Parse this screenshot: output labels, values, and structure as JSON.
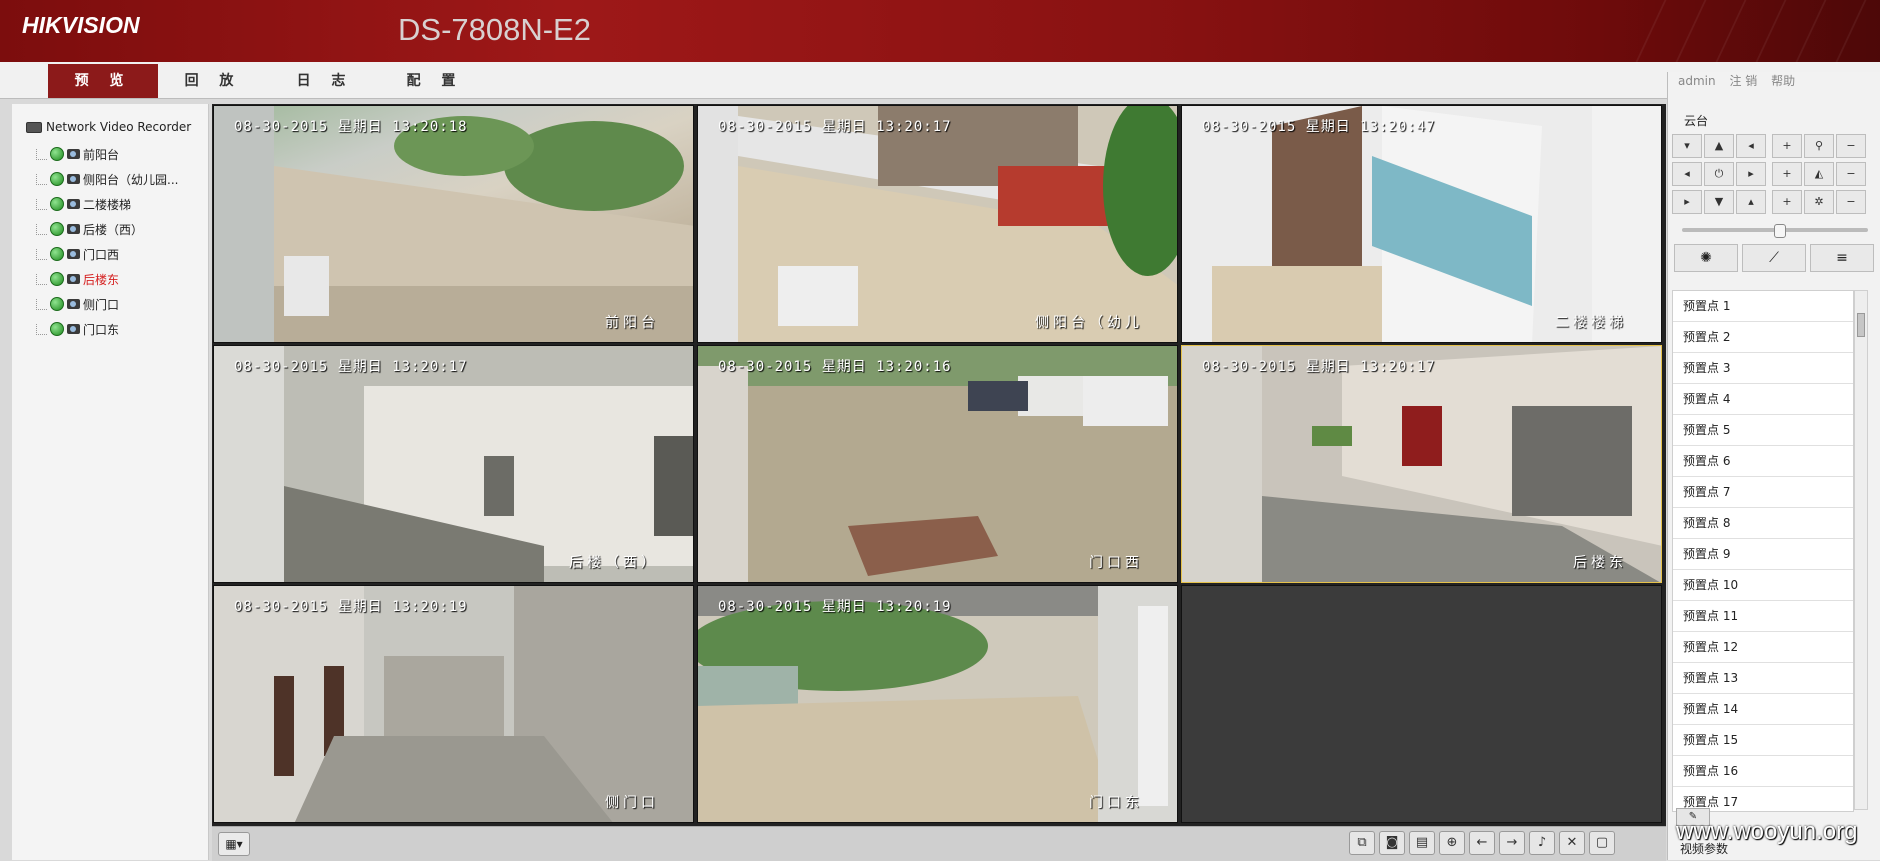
{
  "header": {
    "logo": "HIKVISION",
    "model": "DS-7808N-E2"
  },
  "nav": {
    "tabs": [
      "预 览",
      "回 放",
      "日 志",
      "配 置"
    ],
    "active_tab": "预 览",
    "user": "admin",
    "logout": "注 销",
    "help": "帮助"
  },
  "tree": {
    "root": "Network Video Recorder",
    "cameras": [
      {
        "name": "前阳台",
        "state": "normal"
      },
      {
        "name": "侧阳台（幼儿园...",
        "state": "normal"
      },
      {
        "name": "二楼楼梯",
        "state": "normal"
      },
      {
        "name": "后楼（西）",
        "state": "normal"
      },
      {
        "name": "门口西",
        "state": "normal"
      },
      {
        "name": "后楼东",
        "state": "selected"
      },
      {
        "name": "侧门口",
        "state": "normal"
      },
      {
        "name": "门口东",
        "state": "normal"
      }
    ]
  },
  "video": {
    "cells": [
      {
        "timestamp": "08-30-2015 星期日 13:20:18",
        "name": "前阳台"
      },
      {
        "timestamp": "08-30-2015 星期日 13:20:17",
        "name": "侧阳台（幼儿"
      },
      {
        "timestamp": "08-30-2015 星期日 13:20:47",
        "name": "二楼楼梯"
      },
      {
        "timestamp": "08-30-2015 星期日 13:20:17",
        "name": "后楼（西）"
      },
      {
        "timestamp": "08-30-2015 星期日 13:20:16",
        "name": "门口西"
      },
      {
        "timestamp": "08-30-2015 星期日 13:20:17",
        "name": "后楼东"
      },
      {
        "timestamp": "08-30-2015 星期日 13:20:19",
        "name": "侧门口"
      },
      {
        "timestamp": "08-30-2015 星期日 13:20:19",
        "name": "门口东"
      }
    ]
  },
  "ptz": {
    "title": "云台",
    "presets": [
      "预置点 1",
      "预置点 2",
      "预置点 3",
      "预置点 4",
      "预置点 5",
      "预置点 6",
      "预置点 7",
      "预置点 8",
      "预置点 9",
      "预置点 10",
      "预置点 11",
      "预置点 12",
      "预置点 13",
      "预置点 14",
      "预置点 15",
      "预置点 16",
      "预置点 17"
    ],
    "video_params": "视频参数"
  },
  "watermark": "www.wooyun.org"
}
